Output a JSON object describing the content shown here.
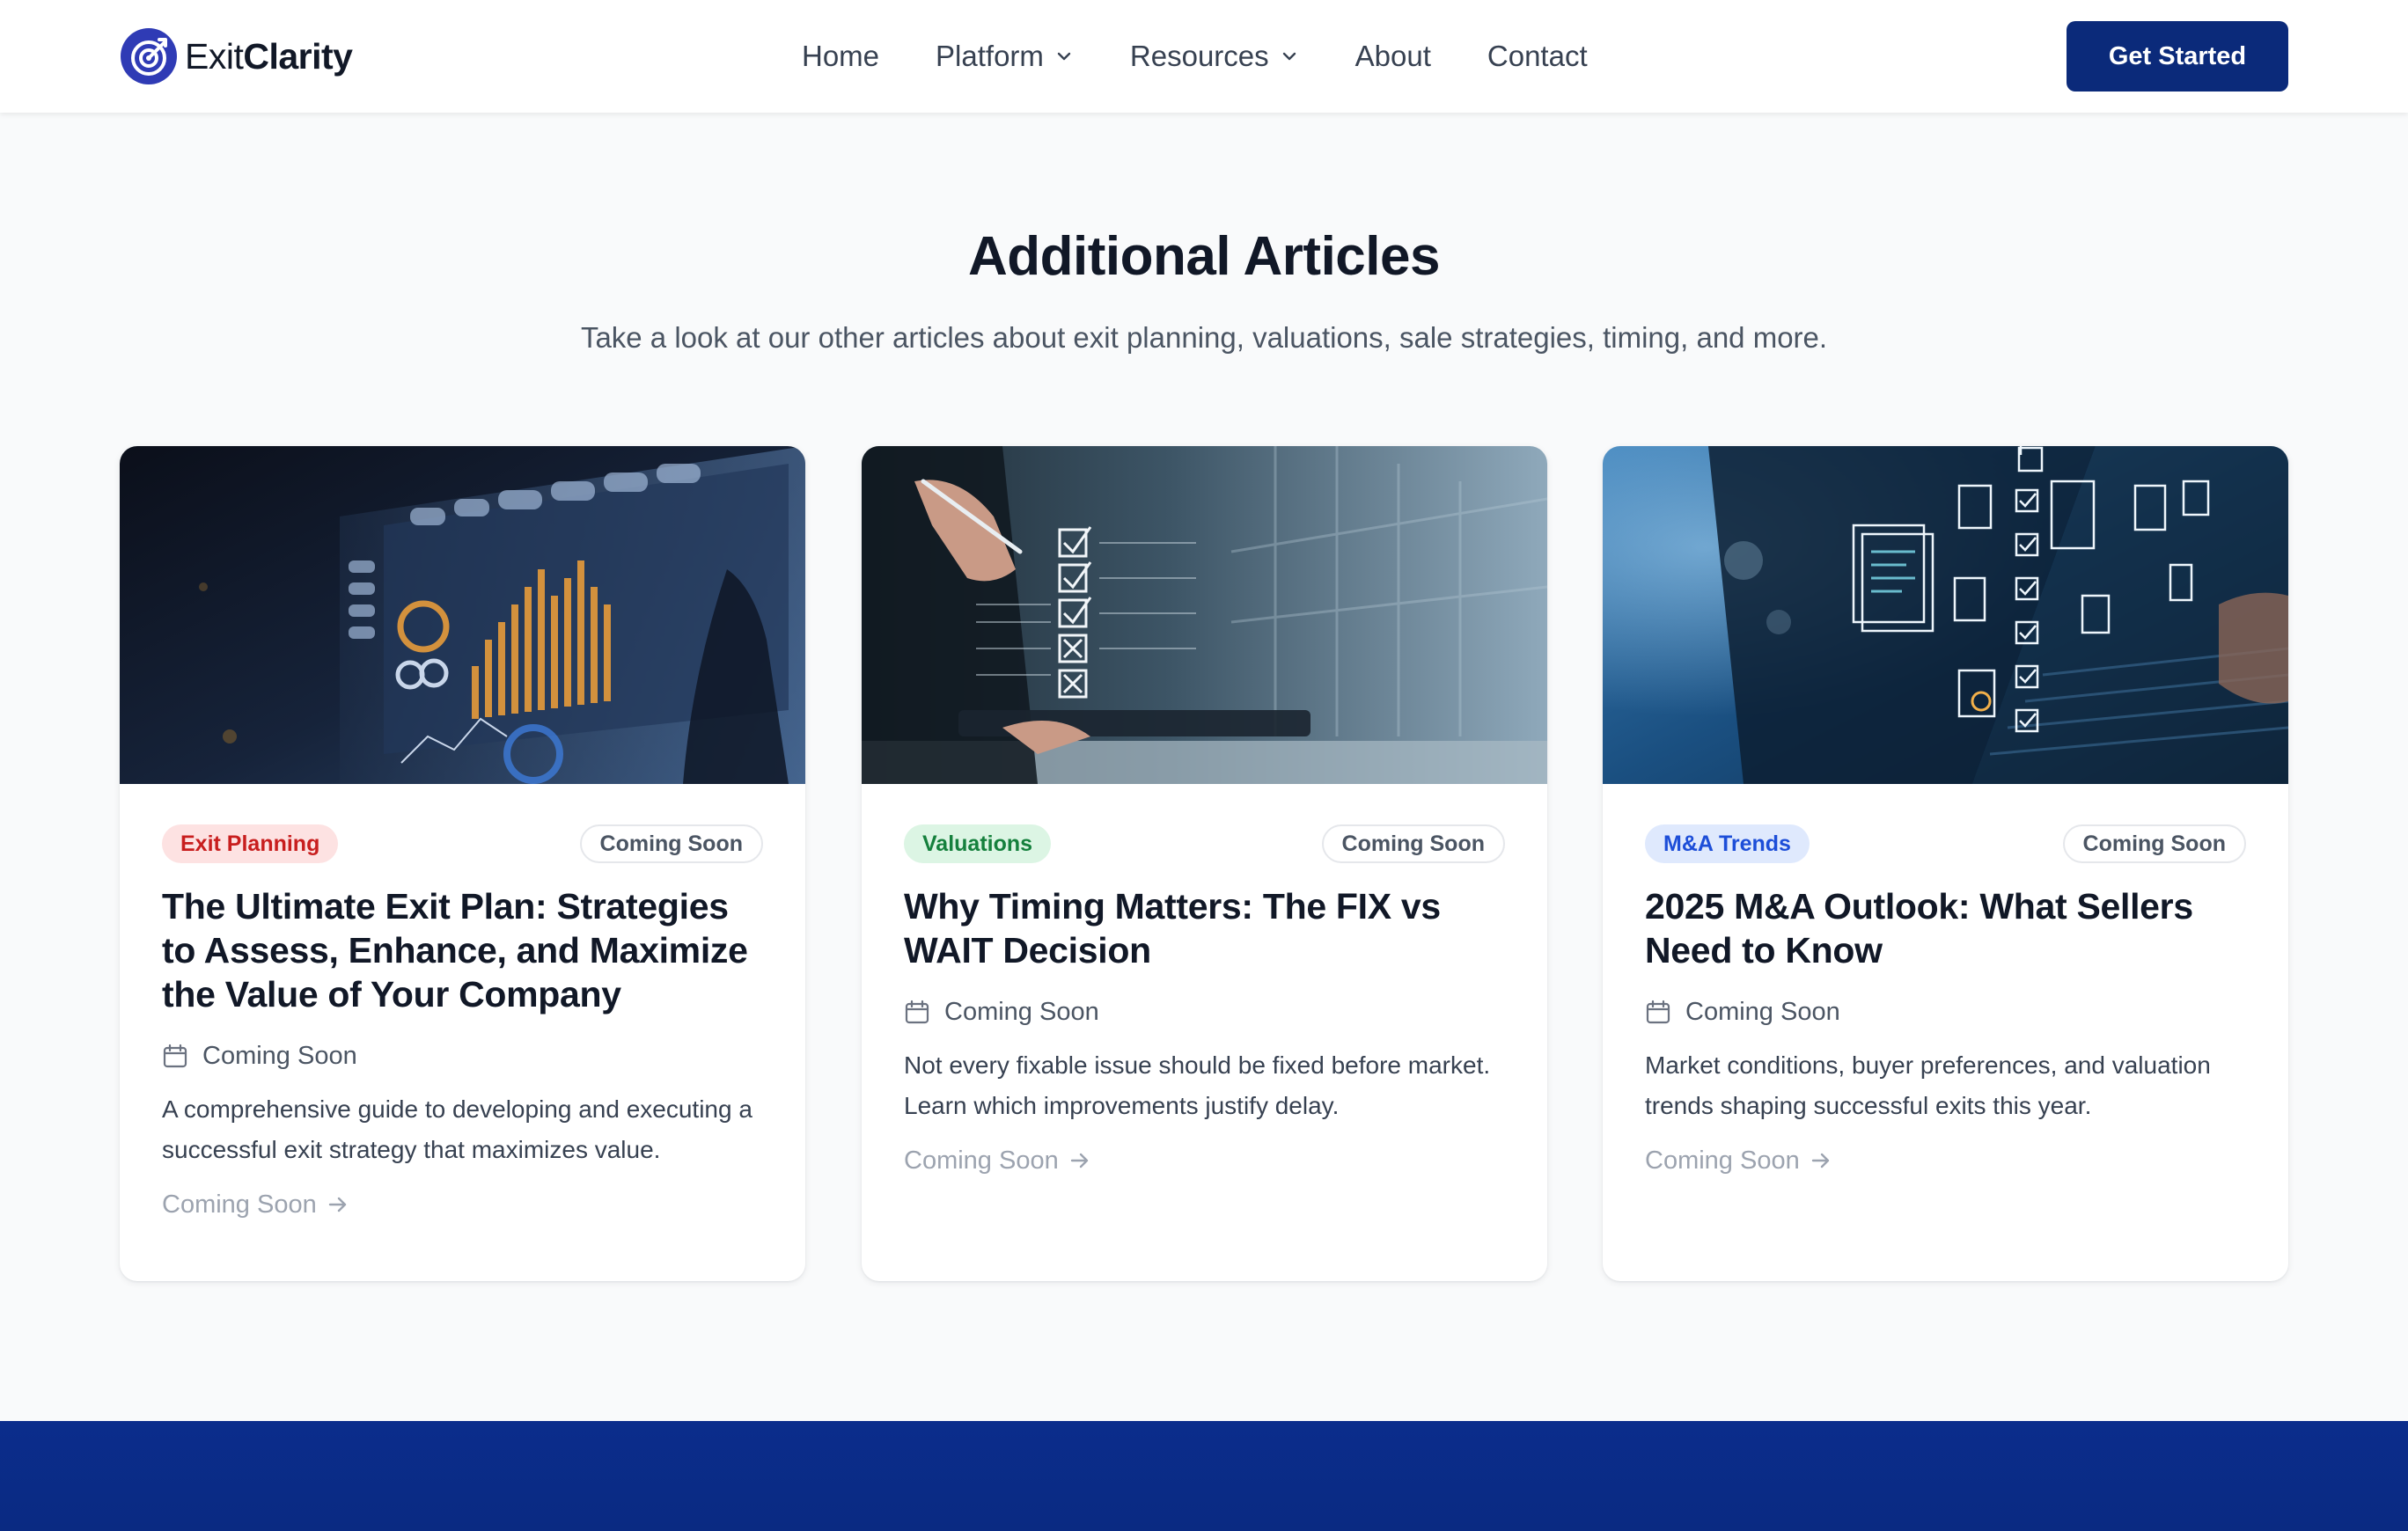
{
  "brand": {
    "name_light": "Exit",
    "name_bold": "Clarity",
    "icon": "target-icon",
    "color": "#2f3bb5"
  },
  "nav": {
    "items": [
      {
        "label": "Home",
        "dropdown": false
      },
      {
        "label": "Platform",
        "dropdown": true
      },
      {
        "label": "Resources",
        "dropdown": true
      },
      {
        "label": "About",
        "dropdown": false
      },
      {
        "label": "Contact",
        "dropdown": false
      }
    ],
    "cta_label": "Get Started",
    "cta_color": "#0b2a7a"
  },
  "section": {
    "title": "Additional Articles",
    "subtitle": "Take a look at our other articles about exit planning, valuations, sale strategies, timing, and more."
  },
  "cards": [
    {
      "image": "financial-dashboard-image",
      "category": "Exit Planning",
      "category_bg": "#fde2e2",
      "category_color": "#c81e1e",
      "status": "Coming Soon",
      "title": "The Ultimate Exit Plan: Strategies to Assess, Enhance, and Maximize the Value of Your Company",
      "date": "Coming Soon",
      "description": "A comprehensive guide to developing and executing a successful exit strategy that maximizes value.",
      "link": "Coming Soon"
    },
    {
      "image": "checklist-tablet-image",
      "category": "Valuations",
      "category_bg": "#dcf5e4",
      "category_color": "#15803d",
      "status": "Coming Soon",
      "title": "Why Timing Matters: The FIX vs WAIT Decision",
      "date": "Coming Soon",
      "description": "Not every fixable issue should be fixed before market. Learn which improvements justify delay.",
      "link": "Coming Soon"
    },
    {
      "image": "laptop-documents-image",
      "category": "M&A Trends",
      "category_bg": "#dfe9fd",
      "category_color": "#1d4ed8",
      "status": "Coming Soon",
      "title": "2025 M&A Outlook: What Sellers Need to Know",
      "date": "Coming Soon",
      "description": "Market conditions, buyer preferences, and valuation trends shaping successful exits this year.",
      "link": "Coming Soon"
    }
  ]
}
